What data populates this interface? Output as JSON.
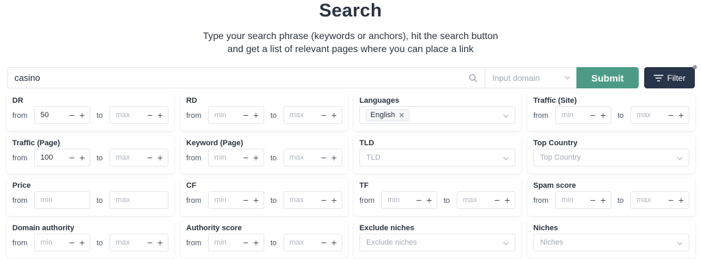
{
  "header": {
    "title": "Search",
    "subtitle_line1": "Type your search phrase (keywords or anchors), hit the search button",
    "subtitle_line2": "and get a list of relevant pages where you can place a link"
  },
  "search": {
    "value": "casino",
    "domain_placeholder": "Input domain",
    "submit_label": "Submit",
    "filter_label": "Filter"
  },
  "filters": {
    "from_label": "from",
    "to_label": "to",
    "dr": {
      "label": "DR",
      "from_value": "50",
      "to_placeholder": "max"
    },
    "rd": {
      "label": "RD",
      "from_placeholder": "min",
      "to_placeholder": "max"
    },
    "languages": {
      "label": "Languages",
      "selected": "English"
    },
    "traffic_site": {
      "label": "Traffic (Site)",
      "from_placeholder": "min",
      "to_placeholder": "max"
    },
    "traffic_page": {
      "label": "Traffic (Page)",
      "from_value": "100",
      "to_placeholder": "max"
    },
    "keyword_page": {
      "label": "Keyword (Page)",
      "from_placeholder": "min",
      "to_placeholder": "max"
    },
    "tld": {
      "label": "TLD",
      "placeholder": "TLD"
    },
    "top_country": {
      "label": "Top Country",
      "placeholder": "Top Country"
    },
    "price": {
      "label": "Price",
      "from_placeholder": "min",
      "to_placeholder": "max"
    },
    "cf": {
      "label": "CF",
      "from_placeholder": "min",
      "to_placeholder": "max"
    },
    "tf": {
      "label": "TF",
      "from_placeholder": "min",
      "to_placeholder": "max"
    },
    "spam_score": {
      "label": "Spam score",
      "from_placeholder": "min",
      "to_placeholder": "max"
    },
    "domain_authority": {
      "label": "Domain authority",
      "from_placeholder": "min",
      "to_placeholder": "max"
    },
    "authority_score": {
      "label": "Authority score",
      "from_placeholder": "min",
      "to_placeholder": "max"
    },
    "exclude_niches": {
      "label": "Exclude niches",
      "placeholder": "Exclude niches"
    },
    "niches": {
      "label": "Niches",
      "placeholder": "Niches"
    }
  },
  "icons": {
    "search": "search-icon",
    "chevron": "chevron-down-icon",
    "filter": "filter-icon",
    "close": "close-icon"
  },
  "colors": {
    "submit": "#4d9a86",
    "filter": "#273449",
    "title": "#2b3340"
  }
}
